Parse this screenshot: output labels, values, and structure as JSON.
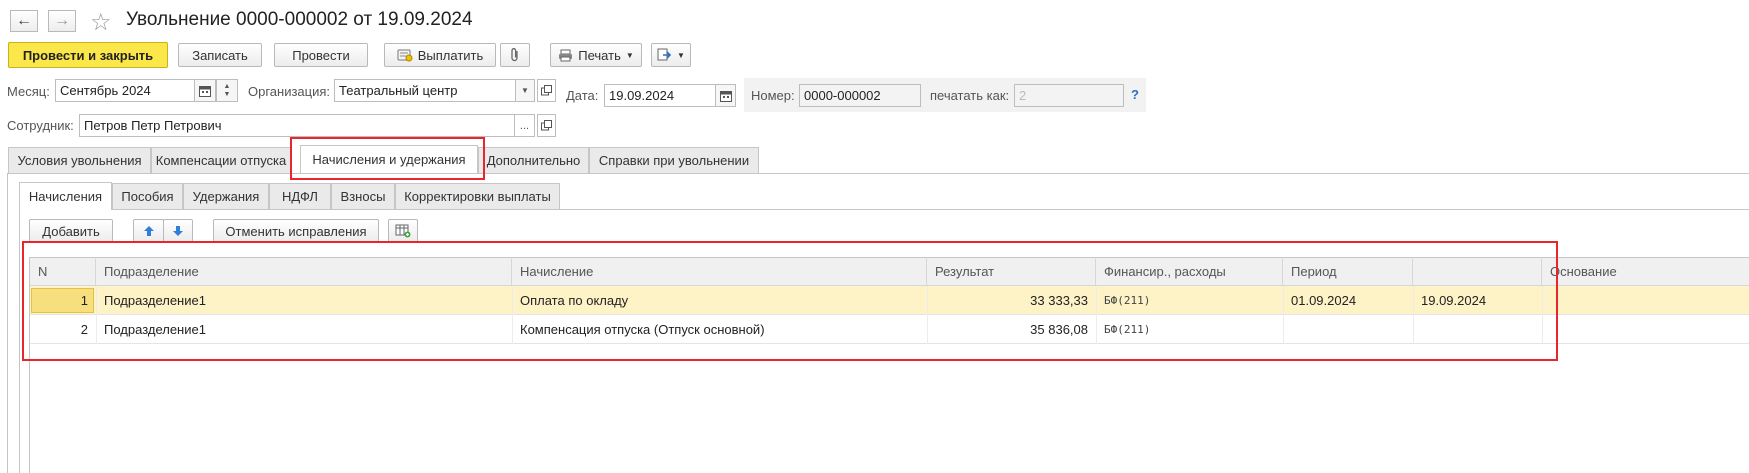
{
  "header": {
    "title": "Увольнение 0000-000002 от 19.09.2024",
    "back_icon": "arrow-left-icon",
    "forward_icon": "arrow-right-icon",
    "favorite_icon": "star-icon"
  },
  "toolbar": {
    "post_and_close": "Провести и закрыть",
    "save": "Записать",
    "post": "Провести",
    "pay": "Выплатить",
    "print": "Печать"
  },
  "form": {
    "month_label": "Месяц:",
    "month_value": "Сентябрь 2024",
    "org_label": "Организация:",
    "org_value": "Театральный центр",
    "date_label": "Дата:",
    "date_value": "19.09.2024",
    "number_label": "Номер:",
    "number_value": "0000-000002",
    "print_as_label": "печатать как:",
    "print_as_value": "2",
    "help": "?",
    "employee_label": "Сотрудник:",
    "employee_value": "Петров Петр Петрович",
    "ellipsis": "..."
  },
  "tabs": [
    "Условия увольнения",
    "Компенсации отпуска",
    "Начисления и удержания",
    "Дополнительно",
    "Справки при увольнении"
  ],
  "subtabs": [
    "Начисления",
    "Пособия",
    "Удержания",
    "НДФЛ",
    "Взносы",
    "Корректировки выплаты"
  ],
  "grid_toolbar": {
    "add": "Добавить",
    "cancel_corrections": "Отменить исправления"
  },
  "table": {
    "columns": [
      "N",
      "Подразделение",
      "Начисление",
      "Результат",
      "Финансир., расходы",
      "Период",
      "",
      "Основание"
    ],
    "rows": [
      [
        "1",
        "Подразделение1",
        "Оплата по окладу",
        "33 333,33",
        "БФ(211)",
        "01.09.2024",
        "19.09.2024",
        ""
      ],
      [
        "2",
        "Подразделение1",
        "Компенсация отпуска (Отпуск основной)",
        "35 836,08",
        "БФ(211)",
        "",
        "",
        ""
      ]
    ]
  },
  "colors": {
    "primary_button": "#fce74a",
    "selected_row": "#fdf3c7",
    "highlight_box": "#e8262b"
  }
}
